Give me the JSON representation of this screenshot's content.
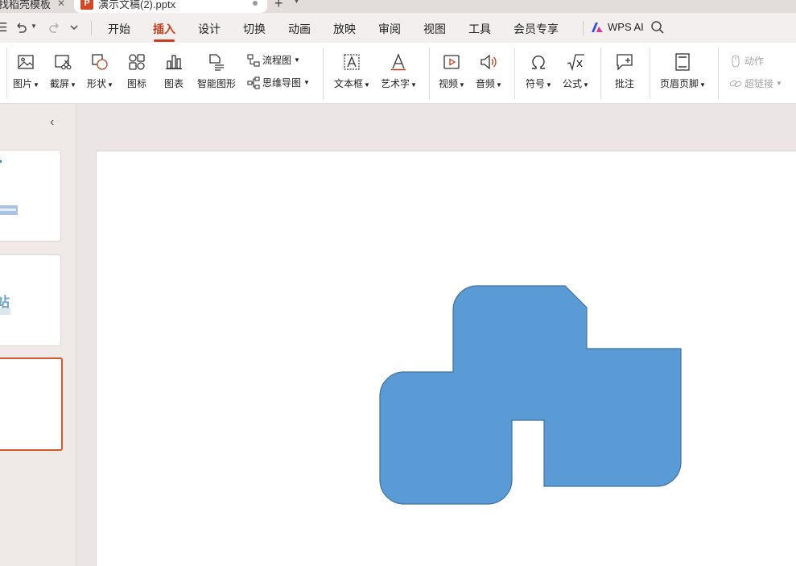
{
  "tabs": {
    "first_tab_label": "找稻壳模板",
    "active_tab_label": "演示文稿(2).pptx",
    "ppt_icon_letter": "P"
  },
  "menu": {
    "items": [
      "开始",
      "插入",
      "设计",
      "切换",
      "动画",
      "放映",
      "审阅",
      "视图",
      "工具",
      "会员专享"
    ],
    "active_item": "插入",
    "wps_ai_label": "WPS AI"
  },
  "ribbon": {
    "picture": "图片",
    "screenshot": "截屏",
    "shape": "形状",
    "icon": "图标",
    "chart": "图表",
    "smartart": "智能图形",
    "flowchart": "流程图",
    "mindmap": "思维导图",
    "textbox": "文本框",
    "wordart": "艺术字",
    "video": "视频",
    "audio": "音频",
    "symbol": "符号",
    "equation": "公式",
    "comment": "批注",
    "header_footer": "页眉页脚",
    "action": "动作",
    "hyperlink": "超链接"
  },
  "thumbnails": {
    "slide2_text": "站"
  },
  "colors": {
    "accent": "#c2401e",
    "shape_fill": "#5b9bd5",
    "shape_stroke": "#41719c",
    "selected_thumb_border": "#d05a2a"
  }
}
